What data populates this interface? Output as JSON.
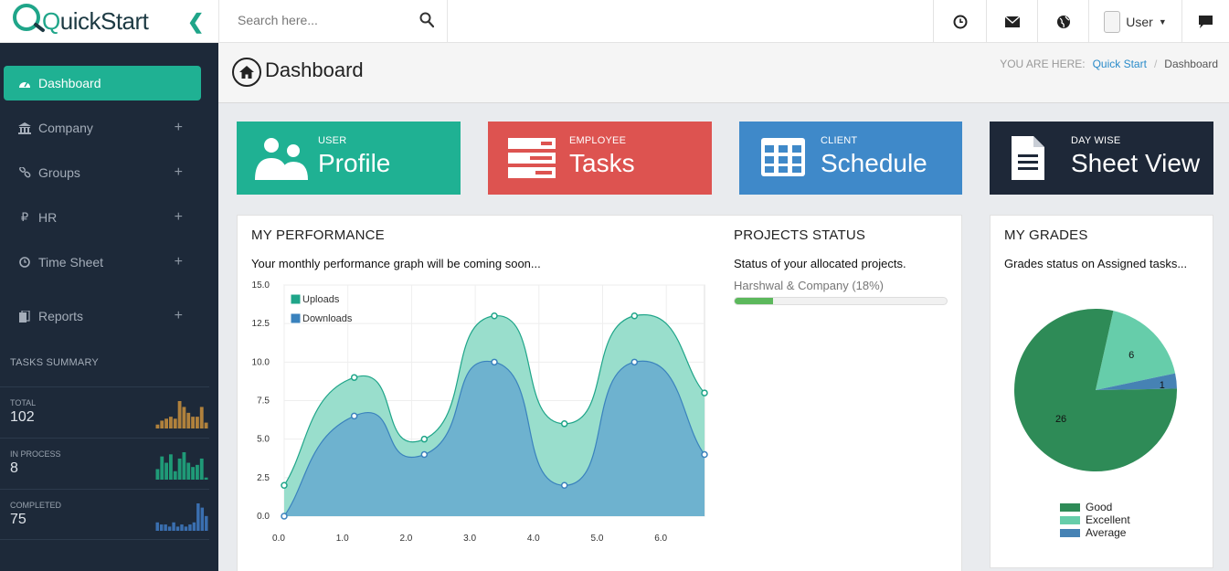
{
  "brand": {
    "logo_q": "Q",
    "logo_rest": "uickStart"
  },
  "search": {
    "placeholder": "Search here..."
  },
  "topbar": {
    "user_label": "User"
  },
  "sidebar": {
    "items": [
      {
        "label": "Dashboard",
        "icon": "dashboard-icon",
        "active": true
      },
      {
        "label": "Company",
        "icon": "bank-icon",
        "expandable": true
      },
      {
        "label": "Groups",
        "icon": "link-icon",
        "expandable": true
      },
      {
        "label": "HR",
        "icon": "ruble-icon",
        "expandable": true
      },
      {
        "label": "Time Sheet",
        "icon": "clock-icon",
        "expandable": true
      },
      {
        "label": "Reports",
        "icon": "files-icon",
        "expandable": true
      }
    ],
    "tasks_title": "TASKS SUMMARY",
    "tasks": [
      {
        "label": "TOTAL",
        "value": "102",
        "color": "#b0813c",
        "bars": [
          2,
          4,
          5,
          6,
          5,
          14,
          11,
          8,
          6,
          6,
          11,
          3
        ]
      },
      {
        "label": "IN PROCESS",
        "value": "8",
        "color": "#1f9a77",
        "bars": [
          5,
          11,
          8,
          12,
          4,
          10,
          13,
          8,
          6,
          7,
          10,
          1
        ]
      },
      {
        "label": "COMPLETED",
        "value": "75",
        "color": "#3a6fb0",
        "bars": [
          4,
          3,
          3,
          2,
          4,
          2,
          3,
          2,
          3,
          4,
          13,
          11,
          7
        ]
      }
    ]
  },
  "header": {
    "title": "Dashboard",
    "breadcrumb_label": "YOU ARE HERE:",
    "breadcrumb_link": "Quick Start",
    "breadcrumb_sep": "/",
    "breadcrumb_current": "Dashboard"
  },
  "tiles": [
    {
      "small": "USER",
      "big": "Profile",
      "color": "#1fb193",
      "icon": "users-icon"
    },
    {
      "small": "EMPLOYEE",
      "big": "Tasks",
      "color": "#dd5350",
      "icon": "tasks-icon"
    },
    {
      "small": "CLIENT",
      "big": "Schedule",
      "color": "#3f89c9",
      "icon": "table-icon"
    },
    {
      "small": "DAY WISE",
      "big": "Sheet View",
      "color": "#1e2838",
      "icon": "document-icon"
    }
  ],
  "performance": {
    "title": "MY PERFORMANCE",
    "subtitle": "Your monthly performance graph will be coming soon..."
  },
  "projects": {
    "title": "PROJECTS STATUS",
    "subtitle": "Status of your allocated projects.",
    "items": [
      {
        "name": "Harshwal & Company (18%)",
        "progress": 0.18
      }
    ]
  },
  "grades": {
    "title": "MY GRADES",
    "subtitle": "Grades status on Assigned tasks..."
  },
  "chart_data": [
    {
      "type": "area",
      "x": [
        0,
        1.1,
        2.2,
        3.3,
        4.4,
        5.5,
        6.6
      ],
      "series": [
        {
          "name": "Uploads",
          "values": [
            2,
            9,
            5,
            13,
            6,
            13,
            8
          ],
          "color": "#93dcc9",
          "line": "#1fa589"
        },
        {
          "name": "Downloads",
          "values": [
            0,
            6.5,
            4,
            10,
            2,
            10,
            4
          ],
          "color": "#6cafcf",
          "line": "#3a82bd"
        }
      ],
      "x_ticks": [
        "0.0",
        "1.0",
        "2.0",
        "3.0",
        "4.0",
        "5.0",
        "6.0"
      ],
      "y_ticks": [
        "0.0",
        "2.5",
        "5.0",
        "7.5",
        "10.0",
        "12.5",
        "15.0"
      ],
      "xlim": [
        0,
        6.6
      ],
      "ylim": [
        0,
        15
      ],
      "legend": "top-left",
      "grid": true
    },
    {
      "type": "pie",
      "labels": [
        "Good",
        "Excellent",
        "Average"
      ],
      "values": [
        26,
        6,
        1
      ],
      "colors": [
        "#2e8b57",
        "#66cdaa",
        "#4682b4"
      ],
      "legend": "bottom"
    }
  ]
}
